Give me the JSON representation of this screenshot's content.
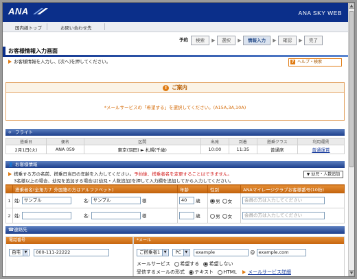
{
  "brand": {
    "logo": "ANA",
    "site": "ANA SKY WEB"
  },
  "nav": {
    "domestic_top": "国内線トップ",
    "contact": "お問い合わせ先"
  },
  "steps": [
    "予約",
    "検索",
    "選択",
    "情報入力",
    "確認",
    "完了"
  ],
  "page": {
    "title": "お客様情報入力画面",
    "instruction": "お客様情報を入力し、[次へ]を押してください。",
    "help": "ヘルプ・検索"
  },
  "notice": {
    "title": "ご案内",
    "message": "*メールサービスの「希望する」を選択してください。(A15A,3A,10A)"
  },
  "flight": {
    "section": "フライト",
    "headers": [
      "搭乗日",
      "便名",
      "区間",
      "出発",
      "到着",
      "搭乗クラス",
      "利用運賃"
    ],
    "row": {
      "date": "2月1日(火)",
      "flight_no": "ANA 059",
      "route": "東京(羽田) ► 札幌(千歳)",
      "dep": "10:00",
      "arr": "11:35",
      "class": "普通席",
      "fare": "普通運賃"
    }
  },
  "passenger": {
    "section": "お客様情報",
    "note1": "搭乗する方の名前、搭乗日当日の年齢を入力してください。",
    "note1_red": "予約後、搭乗者名を変更することはできません。",
    "note2": "3名様以上の場合、幼児を追加する場合は[幼児・人数追加]を押して入力欄を追加してから入力してください。",
    "add_button": "幼児・人数追加",
    "headers": {
      "name": "搭乗者名(全角カナ 外国籍の方はアルファベット)",
      "age": "年齢",
      "sex": "性別",
      "mileage": "ANAマイレージクラブお客様番号(10桁)"
    },
    "rows": [
      {
        "no": "1",
        "sei_label": "姓:",
        "sei": "サンプル",
        "mei_label": "名:",
        "mei": "サンプル",
        "sama": "様",
        "age": "40",
        "age_unit": "歳",
        "male": "男",
        "female": "女",
        "member_placeholder": "会員の方は入力してください"
      },
      {
        "no": "2",
        "sei_label": "姓:",
        "sei": "",
        "mei_label": "名:",
        "mei": "",
        "sama": "様",
        "age": "",
        "age_unit": "歳",
        "male": "男",
        "female": "女",
        "member_placeholder": "会員の方は入力してください"
      }
    ]
  },
  "contact": {
    "section": "連絡先",
    "phone_head": "電話番号",
    "phone_type": "自宅",
    "phone": "000-111-22222",
    "email_head": "*メール",
    "email_owner": "ご搭乗者1",
    "email_device": "PC",
    "email_user": "example",
    "email_at": "@",
    "email_domain": "example.com",
    "mail_service_label": "メールサービス",
    "mail_service_yes": "希望する",
    "mail_service_no": "希望しない",
    "mail_format_label": "受信するメールの形式",
    "mail_format_text": "テキスト",
    "mail_format_html": "HTML",
    "mail_service_link": "メールサービス詳細"
  }
}
